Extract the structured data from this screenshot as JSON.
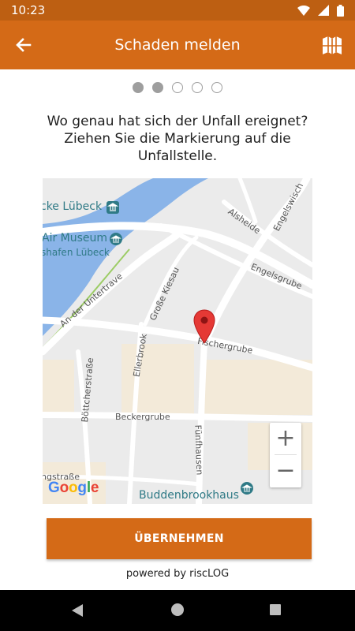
{
  "status_bar": {
    "time": "10:23"
  },
  "app_bar": {
    "title": "Schaden melden"
  },
  "steps": {
    "total": 5,
    "current": 2
  },
  "question": {
    "line1": "Wo genau hat sich der Unfall ereignet?",
    "line2": "Ziehen Sie die Markierung auf die",
    "line3": "Unfallstelle."
  },
  "map": {
    "labels": {
      "luebeck": "cke Lübeck",
      "air_museum": "Air Museum",
      "hafen": "shafen Lübeck",
      "alsheide": "Alsheide",
      "engelswisch": "Engelswisch",
      "engelsgrube": "Engelsgrube",
      "untertrave": "An der Untertrave",
      "kiesau": "Große Kiesau",
      "fischergrube": "Fischergrube",
      "ellerbrook": "Ellerbrook",
      "boettcher": "Böttcherstraße",
      "beckergrube": "Beckergrube",
      "fuenfhausen": "Fünfhausen",
      "ngstrasse": "ngstraße",
      "buddenbrook": "Buddenbrookhaus"
    },
    "zoom_in": "+",
    "zoom_out": "−",
    "attribution": {
      "g1": "G",
      "o1": "o",
      "o2": "o",
      "g2": "g",
      "l": "l",
      "e": "e"
    }
  },
  "colors": {
    "accent": "#d46a17",
    "status_bar": "#bd5f12",
    "water": "#8ab4e8",
    "poi": "#2f7a86",
    "pin": "#e53935"
  },
  "apply_button": {
    "label": "ÜBERNEHMEN"
  },
  "footer": {
    "powered": "powered by riscLOG"
  }
}
